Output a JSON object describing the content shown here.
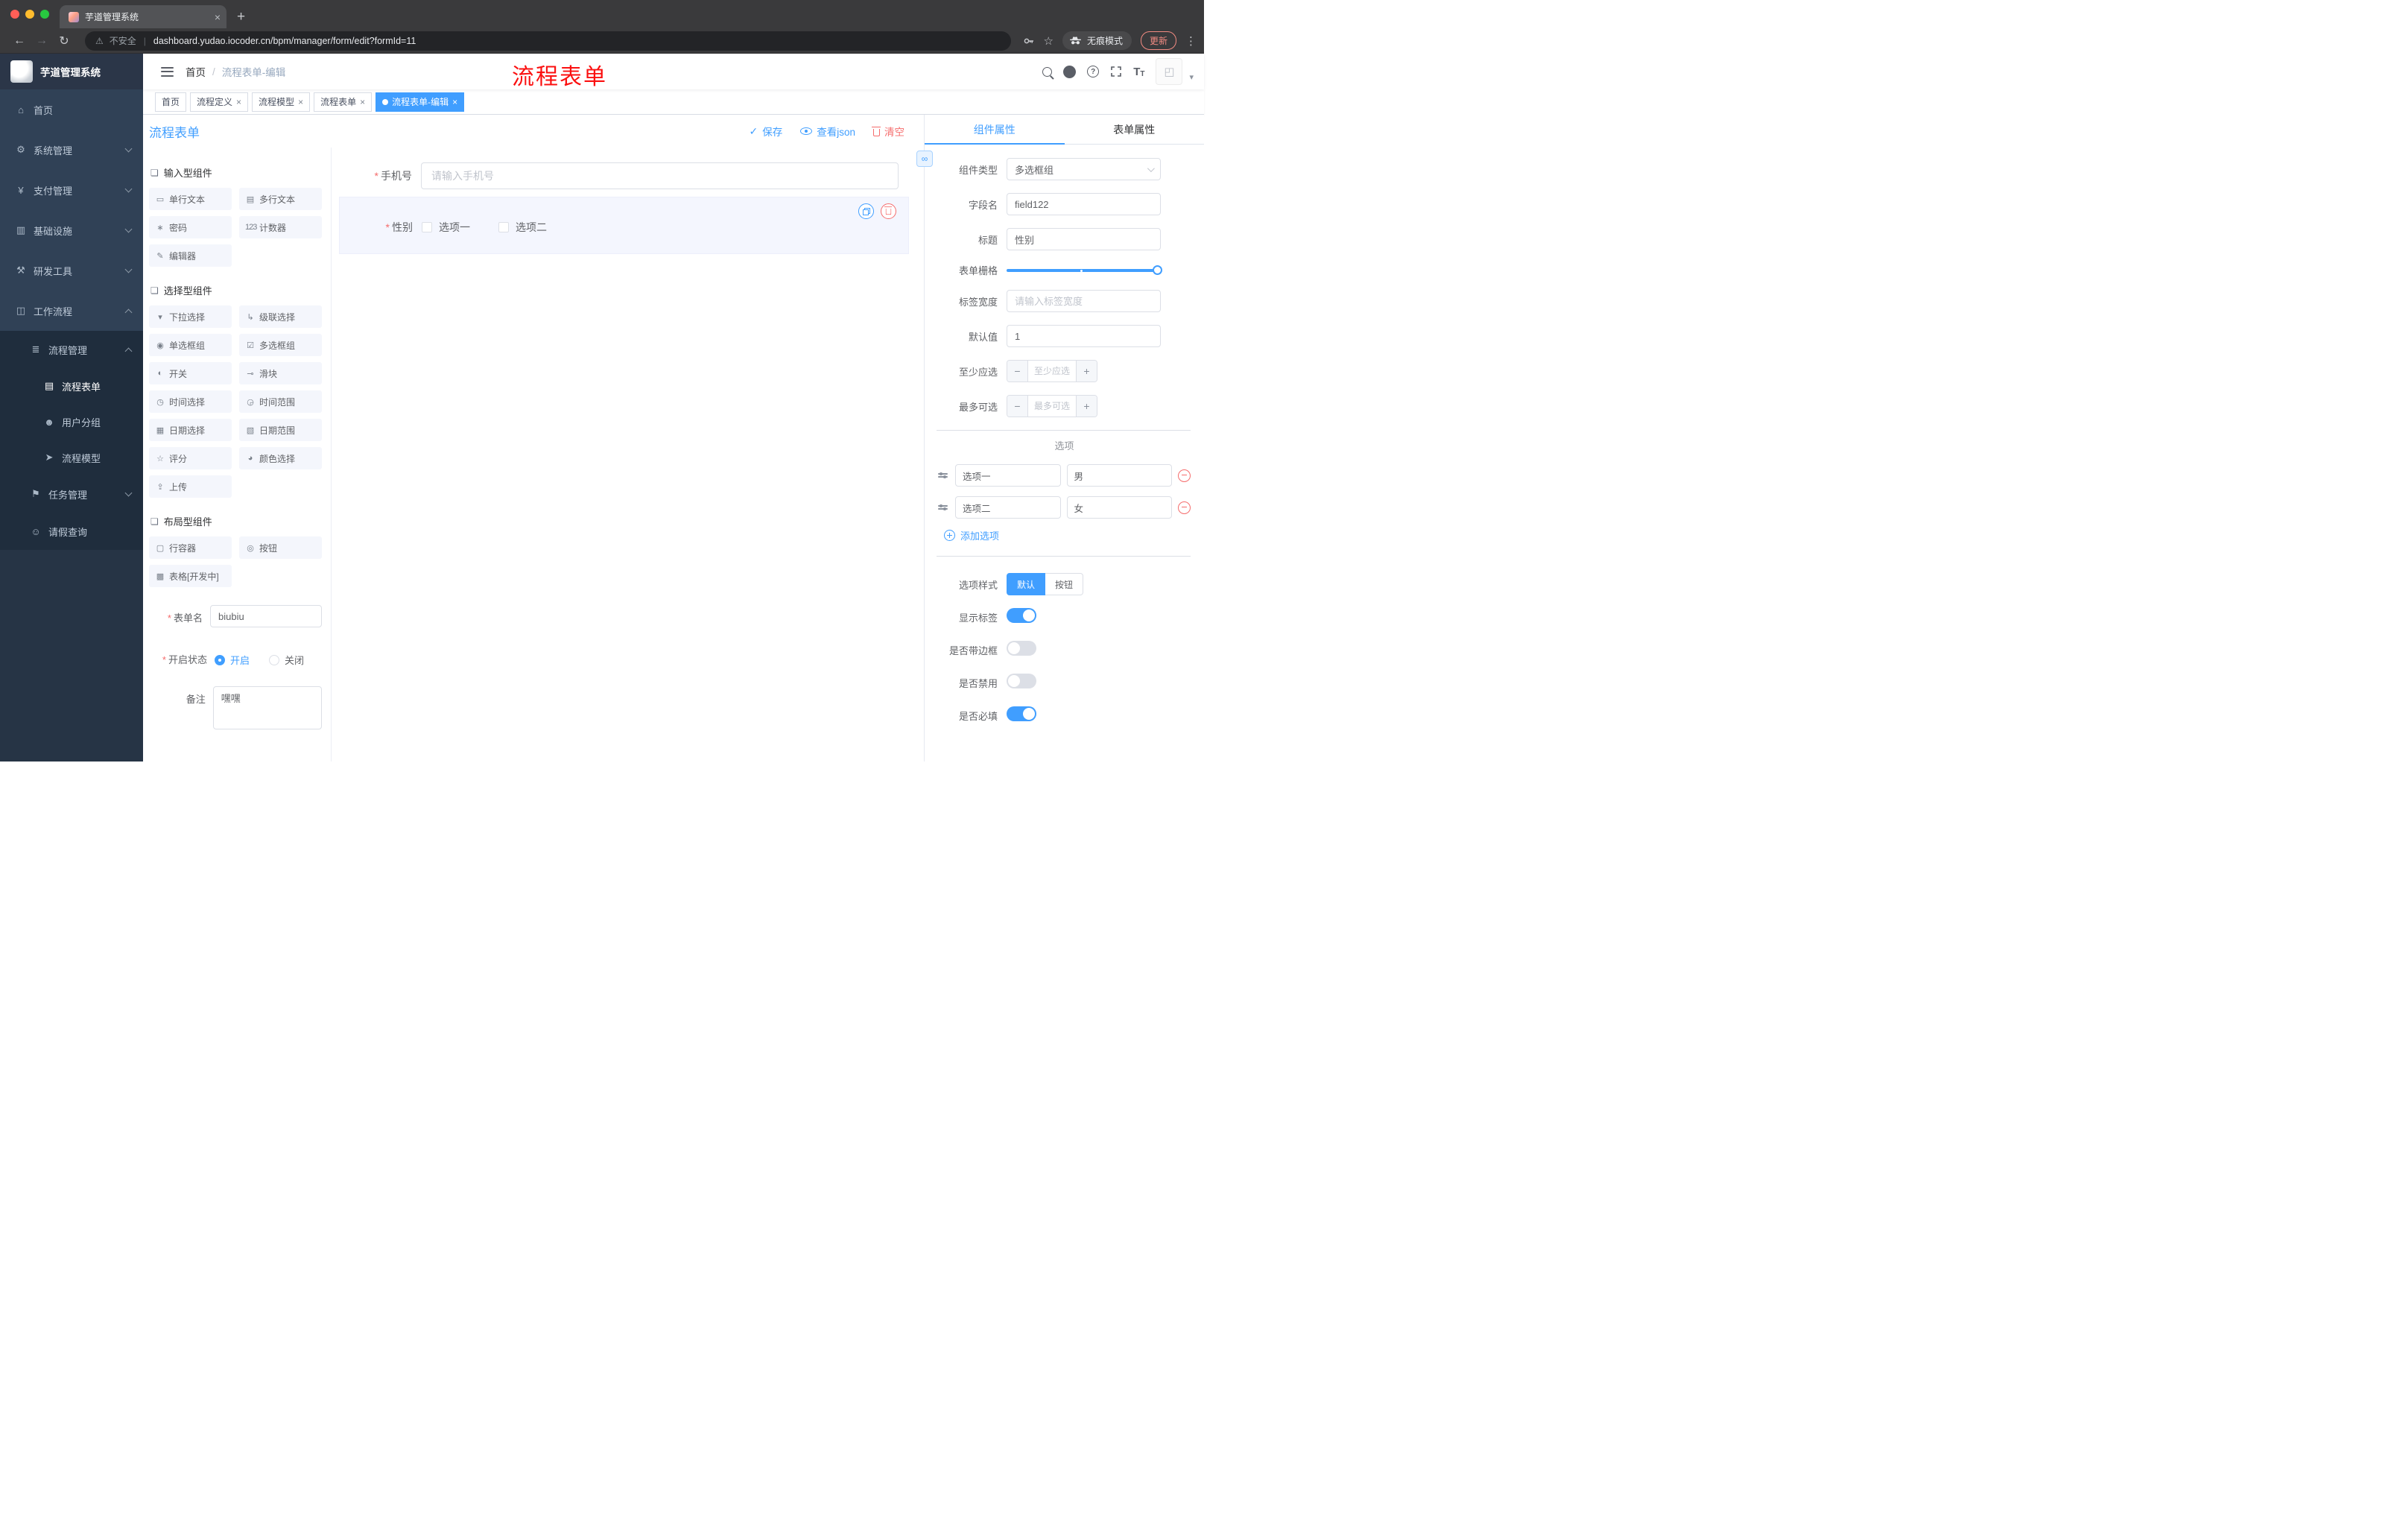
{
  "colors": {
    "accent": "#409eff",
    "danger": "#f56c6c",
    "annotation": "#fb1010",
    "sidebar_bg": "#304156",
    "submenu_bg": "#1f2d3d"
  },
  "browser": {
    "tab_title": "芋道管理系统",
    "security_label": "不安全",
    "url": "dashboard.yudao.iocoder.cn/bpm/manager/form/edit?formId=11",
    "incognito_label": "无痕模式",
    "update_label": "更新"
  },
  "sidebar": {
    "app_title": "芋道管理系统",
    "items": [
      {
        "label": "首页",
        "glyph": "⌂"
      },
      {
        "label": "系统管理",
        "glyph": "⚙"
      },
      {
        "label": "支付管理",
        "glyph": "¥"
      },
      {
        "label": "基础设施",
        "glyph": "▥"
      },
      {
        "label": "研发工具",
        "glyph": "⚒"
      },
      {
        "label": "工作流程",
        "glyph": "◫"
      },
      {
        "label": "流程管理",
        "glyph": "≣"
      },
      {
        "label": "流程表单",
        "glyph": "▤"
      },
      {
        "label": "用户分组",
        "glyph": "☻"
      },
      {
        "label": "流程模型",
        "glyph": "➤"
      },
      {
        "label": "任务管理",
        "glyph": "⚑"
      },
      {
        "label": "请假查询",
        "glyph": "☺"
      }
    ]
  },
  "navbar": {
    "breadcrumb_home": "首页",
    "breadcrumb_separator": "/",
    "breadcrumb_current": "流程表单-编辑",
    "annotation": "流程表单"
  },
  "tags": [
    {
      "label": "首页"
    },
    {
      "label": "流程定义"
    },
    {
      "label": "流程模型"
    },
    {
      "label": "流程表单"
    },
    {
      "label": "流程表单-编辑"
    }
  ],
  "designer": {
    "title": "流程表单",
    "actions": {
      "save": "保存",
      "view_json": "查看json",
      "clear": "清空"
    },
    "palette": {
      "sections": [
        {
          "title": "输入型组件",
          "glyph": "❏",
          "items": [
            {
              "label": "单行文本",
              "glyph": "▭"
            },
            {
              "label": "多行文本",
              "glyph": "▤"
            },
            {
              "label": "密码",
              "glyph": "∗"
            },
            {
              "label": "计数器",
              "glyph": "123"
            },
            {
              "label": "编辑器",
              "glyph": "✎"
            }
          ]
        },
        {
          "title": "选择型组件",
          "glyph": "❏",
          "items": [
            {
              "label": "下拉选择",
              "glyph": "▾"
            },
            {
              "label": "级联选择",
              "glyph": "↳"
            },
            {
              "label": "单选框组",
              "glyph": "◉"
            },
            {
              "label": "多选框组",
              "glyph": "☑"
            },
            {
              "label": "开关",
              "glyph": "◐"
            },
            {
              "label": "滑块",
              "glyph": "⊸"
            },
            {
              "label": "时间选择",
              "glyph": "◷"
            },
            {
              "label": "时间范围",
              "glyph": "◶"
            },
            {
              "label": "日期选择",
              "glyph": "▦"
            },
            {
              "label": "日期范围",
              "glyph": "▧"
            },
            {
              "label": "评分",
              "glyph": "☆"
            },
            {
              "label": "颜色选择",
              "glyph": "◕"
            },
            {
              "label": "上传",
              "glyph": "⇪"
            }
          ]
        },
        {
          "title": "布局型组件",
          "glyph": "❏",
          "items": [
            {
              "label": "行容器",
              "glyph": "▢"
            },
            {
              "label": "按钮",
              "glyph": "◎"
            },
            {
              "label": "表格[开发中]",
              "glyph": "▩"
            }
          ]
        }
      ]
    },
    "meta": {
      "name_label": "表单名",
      "name_value": "biubiu",
      "status_label": "开启状态",
      "status_on": "开启",
      "status_off": "关闭",
      "remark_label": "备注",
      "remark_value": "嘿嘿"
    },
    "canvas": {
      "phone_label": "手机号",
      "phone_placeholder": "请输入手机号",
      "gender_label": "性别",
      "gender_option1": "选项一",
      "gender_option2": "选项二"
    }
  },
  "props": {
    "tabs": [
      "组件属性",
      "表单属性"
    ],
    "component_type": {
      "label": "组件类型",
      "value": "多选框组"
    },
    "field_name": {
      "label": "字段名",
      "value": "field122"
    },
    "title_field": {
      "label": "标题",
      "value": "性别"
    },
    "grid": {
      "label": "表单栅格"
    },
    "tag_width": {
      "label": "标签宽度",
      "placeholder": "请输入标签宽度"
    },
    "default_value": {
      "label": "默认值",
      "value": "1"
    },
    "min_select": {
      "label": "至少应选",
      "placeholder": "至少应选"
    },
    "max_select": {
      "label": "最多可选",
      "placeholder": "最多可选"
    },
    "options_title": "选项",
    "options": [
      {
        "label": "选项一",
        "value": "男"
      },
      {
        "label": "选项二",
        "value": "女"
      }
    ],
    "add_option_label": "添加选项",
    "style": {
      "label": "选项样式",
      "option_default": "默认",
      "option_button": "按钮"
    },
    "toggles": {
      "show_label": "显示标签",
      "border_label": "是否带边框",
      "disabled_label": "是否禁用",
      "required_label": "是否必填"
    }
  }
}
